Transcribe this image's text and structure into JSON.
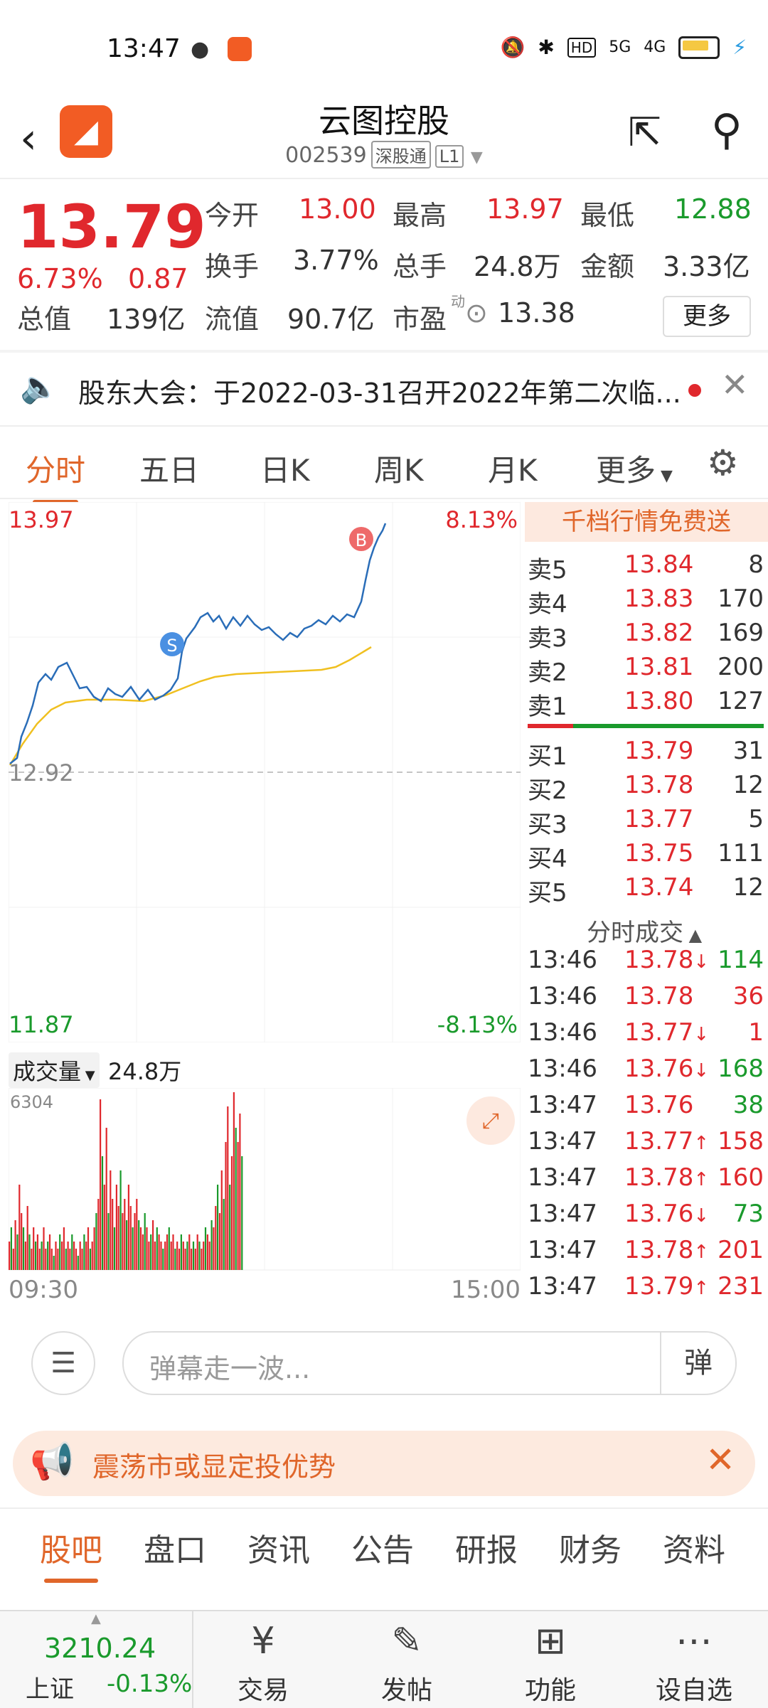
{
  "status_bar": {
    "time": "13:47",
    "icons": [
      "wechat-icon",
      "app-notify-icon",
      "mute-icon",
      "bluetooth-icon",
      "hd-icon",
      "5g-signal-icon",
      "4g-signal-icon",
      "battery-icon",
      "charging-icon"
    ],
    "hd": "HD",
    "g5": "5G",
    "g4": "4G"
  },
  "header": {
    "title": "云图控股",
    "code": "002539",
    "tag1": "深股通",
    "tag2": "L1"
  },
  "quote": {
    "price": "13.79",
    "change_pct": "6.73%",
    "change": "0.87",
    "open_label": "今开",
    "open": "13.00",
    "high_label": "最高",
    "high": "13.97",
    "low_label": "最低",
    "low": "12.88",
    "turnover_label": "换手",
    "turnover": "3.77%",
    "volume_label": "总手",
    "volume": "24.8万",
    "amount_label": "金额",
    "amount": "3.33亿",
    "mktcap_label": "总值",
    "mktcap": "139亿",
    "float_label": "流值",
    "float": "90.7亿",
    "pe_label": "市盈",
    "pe_sup": "动",
    "pe": "13.38",
    "more_label": "更多"
  },
  "notice": {
    "text": "股东大会：于2022-03-31召开2022年第二次临..."
  },
  "chart_tabs": [
    "分时",
    "五日",
    "日K",
    "周K",
    "月K",
    "更多"
  ],
  "chart": {
    "top_price": "13.97",
    "top_pct": "8.13%",
    "mid_price": "12.92",
    "bottom_price": "11.87",
    "bottom_pct": "-8.13%",
    "marker_s": "S",
    "marker_b": "B"
  },
  "volume_panel": {
    "label": "成交量",
    "value": "24.8万",
    "max": "6304",
    "start_time": "09:30",
    "end_time": "15:00"
  },
  "order_book": {
    "promo": "千档行情免费送",
    "asks": [
      {
        "label": "卖5",
        "price": "13.84",
        "vol": "8"
      },
      {
        "label": "卖4",
        "price": "13.83",
        "vol": "170"
      },
      {
        "label": "卖3",
        "price": "13.82",
        "vol": "169"
      },
      {
        "label": "卖2",
        "price": "13.81",
        "vol": "200"
      },
      {
        "label": "卖1",
        "price": "13.80",
        "vol": "127"
      }
    ],
    "bids": [
      {
        "label": "买1",
        "price": "13.79",
        "vol": "31"
      },
      {
        "label": "买2",
        "price": "13.78",
        "vol": "12"
      },
      {
        "label": "买3",
        "price": "13.77",
        "vol": "5"
      },
      {
        "label": "买4",
        "price": "13.75",
        "vol": "111"
      },
      {
        "label": "买5",
        "price": "13.74",
        "vol": "12"
      }
    ],
    "ticks_title": "分时成交",
    "ticks": [
      {
        "time": "13:46",
        "price": "13.78",
        "arrow": "↓",
        "vol": "114",
        "color": "green"
      },
      {
        "time": "13:46",
        "price": "13.78",
        "arrow": "",
        "vol": "36",
        "color": "red"
      },
      {
        "time": "13:46",
        "price": "13.77",
        "arrow": "↓",
        "vol": "1",
        "color": "red"
      },
      {
        "time": "13:46",
        "price": "13.76",
        "arrow": "↓",
        "vol": "168",
        "color": "green"
      },
      {
        "time": "13:47",
        "price": "13.76",
        "arrow": "",
        "vol": "38",
        "color": "green"
      },
      {
        "time": "13:47",
        "price": "13.77",
        "arrow": "↑",
        "vol": "158",
        "color": "red"
      },
      {
        "time": "13:47",
        "price": "13.78",
        "arrow": "↑",
        "vol": "160",
        "color": "red"
      },
      {
        "time": "13:47",
        "price": "13.76",
        "arrow": "↓",
        "vol": "73",
        "color": "green"
      },
      {
        "time": "13:47",
        "price": "13.78",
        "arrow": "↑",
        "vol": "201",
        "color": "red"
      },
      {
        "time": "13:47",
        "price": "13.79",
        "arrow": "↑",
        "vol": "231",
        "color": "red"
      }
    ]
  },
  "danmu": {
    "placeholder": "弹幕走一波...",
    "send": "弹"
  },
  "ad": {
    "text": "震荡市或显定投优势"
  },
  "bottom_tabs": [
    "股吧",
    "盘口",
    "资讯",
    "公告",
    "研报",
    "财务",
    "资料"
  ],
  "bottom_nav": {
    "index_value": "3210.24",
    "index_name": "上证",
    "index_change": "-0.13%",
    "items": [
      "交易",
      "发帖",
      "功能",
      "设自选"
    ]
  },
  "colors": {
    "up": "#e0282d",
    "down": "#1a9a2c",
    "accent": "#e0662a",
    "avg_line": "#f0c020",
    "price_line": "#2a6db8"
  }
}
